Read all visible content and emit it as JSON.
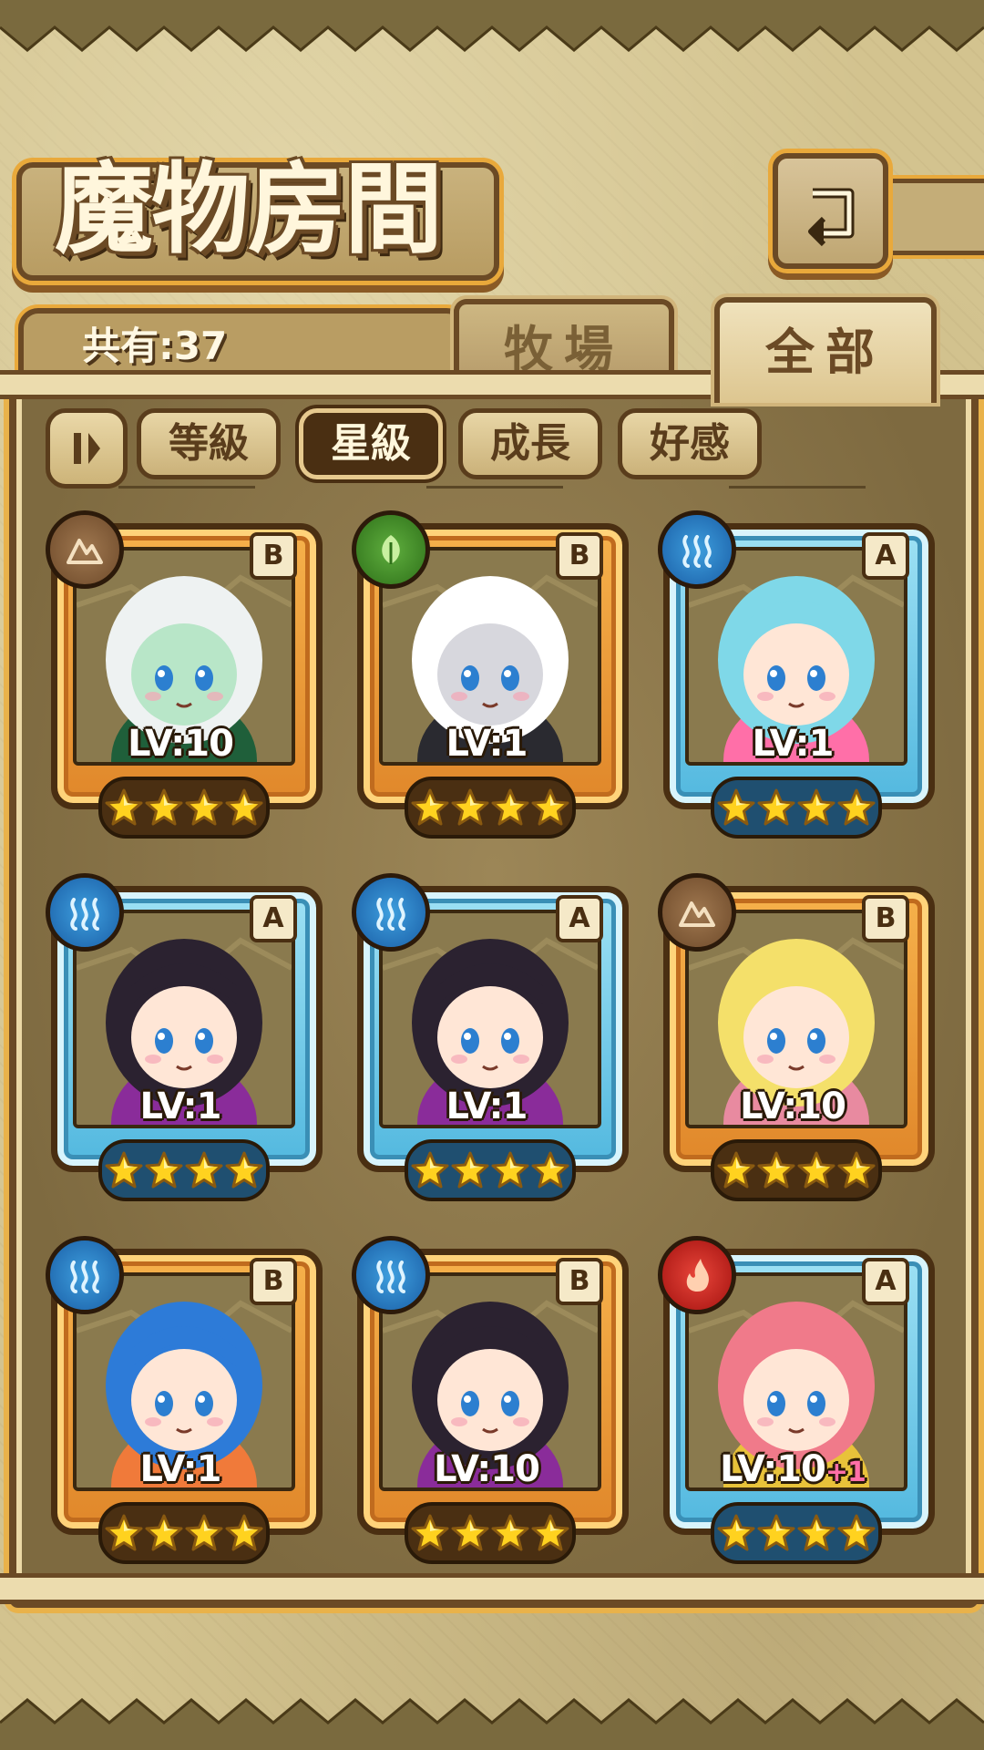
{
  "header": {
    "title": "魔物房間"
  },
  "count": {
    "text": "共有:37"
  },
  "tabs": [
    {
      "label": "牧場",
      "active": false
    },
    {
      "label": "全部",
      "active": true
    }
  ],
  "sort": {
    "buttons": [
      {
        "label": "等級",
        "active": false
      },
      {
        "label": "星級",
        "active": true
      },
      {
        "label": "成長",
        "active": false
      },
      {
        "label": "好感",
        "active": false
      }
    ]
  },
  "colors": {
    "orange_frame": "#f6b14b",
    "blue_frame": "#52b8df",
    "panel": "#8e7849",
    "dark_brown": "#4a2f12"
  },
  "cards": [
    {
      "element": "earth",
      "rarity": "B",
      "level": "LV:10",
      "plus": "",
      "stars": 4,
      "frame": "orange",
      "hair": "#eef2f2",
      "skin": "#b8e6c8",
      "accent": "#1f5f3a"
    },
    {
      "element": "grass",
      "rarity": "B",
      "level": "LV:1",
      "plus": "",
      "stars": 4,
      "frame": "orange",
      "hair": "#ffffff",
      "skin": "#d7d7dd",
      "accent": "#2a2a30"
    },
    {
      "element": "water",
      "rarity": "A",
      "level": "LV:1",
      "plus": "",
      "stars": 4,
      "frame": "blue",
      "hair": "#7fd8e8",
      "skin": "#ffe6d6",
      "accent": "#ff6fa8"
    },
    {
      "element": "water",
      "rarity": "A",
      "level": "LV:1",
      "plus": "",
      "stars": 4,
      "frame": "blue",
      "hair": "#2b2230",
      "skin": "#ffe6d6",
      "accent": "#8a2c9a"
    },
    {
      "element": "water",
      "rarity": "A",
      "level": "LV:1",
      "plus": "",
      "stars": 4,
      "frame": "blue",
      "hair": "#2b2230",
      "skin": "#ffe6d6",
      "accent": "#8a2c9a"
    },
    {
      "element": "earth",
      "rarity": "B",
      "level": "LV:10",
      "plus": "",
      "stars": 4,
      "frame": "orange",
      "hair": "#f4e06a",
      "skin": "#ffe6d6",
      "accent": "#e88aa0"
    },
    {
      "element": "water",
      "rarity": "B",
      "level": "LV:1",
      "plus": "",
      "stars": 4,
      "frame": "orange",
      "hair": "#2d7bd8",
      "skin": "#ffe6d6",
      "accent": "#f07a3a"
    },
    {
      "element": "water",
      "rarity": "B",
      "level": "LV:10",
      "plus": "",
      "stars": 4,
      "frame": "orange",
      "hair": "#2b2230",
      "skin": "#ffe6d6",
      "accent": "#8a2c9a"
    },
    {
      "element": "fire",
      "rarity": "A",
      "level": "LV:10",
      "plus": "+1",
      "stars": 4,
      "frame": "blue",
      "hair": "#f07a8a",
      "skin": "#ffe6d6",
      "accent": "#e8c23a"
    }
  ]
}
